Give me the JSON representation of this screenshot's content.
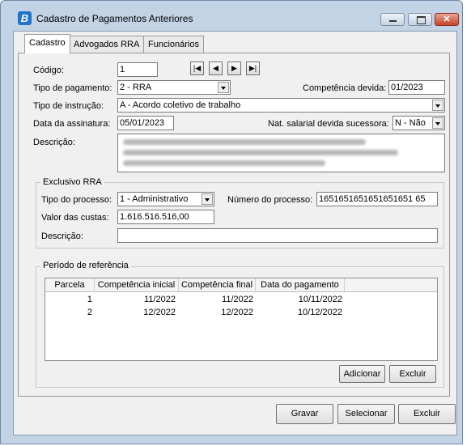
{
  "window": {
    "title": "Cadastro de Pagamentos Anteriores",
    "icon_letter": "B"
  },
  "tabs": [
    {
      "label": "Cadastro"
    },
    {
      "label": "Advogados RRA"
    },
    {
      "label": "Funcionários"
    }
  ],
  "form": {
    "codigo_label": "Código:",
    "codigo_value": "1",
    "tipo_pagamento_label": "Tipo de pagamento:",
    "tipo_pagamento_value": "2 - RRA",
    "competencia_label": "Competência devida:",
    "competencia_value": "01/2023",
    "tipo_instrucao_label": "Tipo de instrução:",
    "tipo_instrucao_value": "A - Acordo coletivo de trabalho",
    "data_assinatura_label": "Data da assinatura:",
    "data_assinatura_value": "05/01/2023",
    "nat_salarial_label": "Nat. salarial devida sucessora:",
    "nat_salarial_value": "N - Não",
    "descricao_label": "Descrição:"
  },
  "rra": {
    "group_label": "Exclusivo RRA",
    "tipo_processo_label": "Tipo do processo:",
    "tipo_processo_value": "1 - Administrativo",
    "numero_processo_label": "Número do processo:",
    "numero_processo_value": "1651651651651651651 65",
    "valor_custas_label": "Valor das custas:",
    "valor_custas_value": "1.616.516.516,00",
    "descricao_label": "Descrição:",
    "descricao_value": ""
  },
  "periodo": {
    "group_label": "Período de referência",
    "columns": [
      "Parcela",
      "Competência inicial",
      "Competência final",
      "Data do pagamento"
    ],
    "rows": [
      {
        "parcela": "1",
        "inicial": "11/2022",
        "final": "11/2022",
        "pagamento": "10/11/2022"
      },
      {
        "parcela": "2",
        "inicial": "12/2022",
        "final": "12/2022",
        "pagamento": "10/12/2022"
      }
    ],
    "add_label": "Adicionar",
    "delete_label": "Excluir"
  },
  "footer": {
    "save_label": "Gravar",
    "select_label": "Selecionar",
    "delete_label": "Excluir"
  }
}
